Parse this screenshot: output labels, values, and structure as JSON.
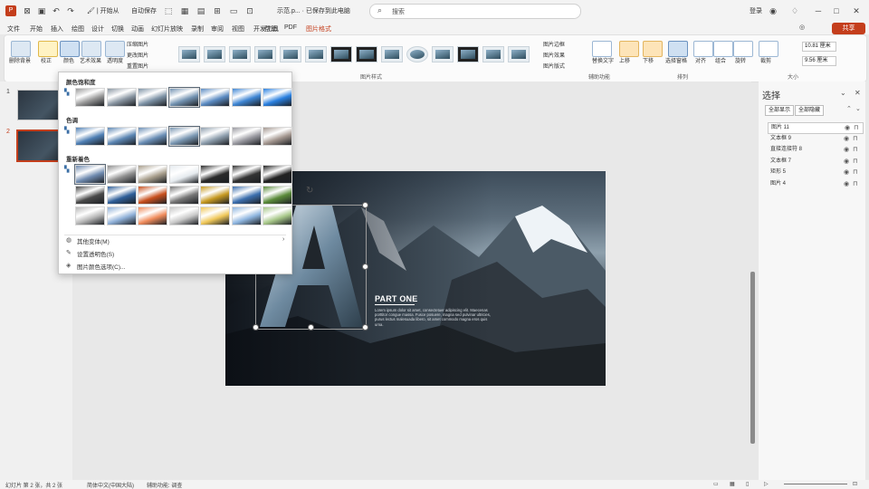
{
  "titlebar": {
    "menu_quick": [
      "文件",
      "开始",
      "插入",
      "绘图",
      "设计",
      "切换",
      "动画",
      "幻灯片放映",
      "审阅",
      "视图",
      "开发工具",
      "帮助",
      "PDF"
    ],
    "autosave_label": "自动保存",
    "doc_title": "示范.p... · 已保存到此电脑",
    "search_placeholder": "搜索",
    "user": "登录",
    "share_label": "共享"
  },
  "tabs": {
    "file": "文件",
    "home": "开始",
    "insert": "插入",
    "draw": "绘图",
    "design": "设计",
    "transitions": "切换",
    "animations": "动画",
    "slideshow": "幻灯片放映",
    "record": "录制",
    "review": "审阅",
    "view": "视图",
    "developer": "开发工具",
    "help": "帮助",
    "pdf": "PDF",
    "picture_format": "图片格式"
  },
  "ribbon": {
    "remove_bg": "删除背景",
    "corrections": "校正",
    "color": "颜色",
    "artistic": "艺术效果",
    "transparency": "透明度",
    "compress": "压缩图片",
    "change_picture": "更改图片",
    "reset_picture": "重置图片",
    "picture_styles_label": "图片样式",
    "picture_border": "图片边框",
    "picture_effects": "图片效果",
    "picture_layout": "图片版式",
    "accessibility_label": "辅助功能",
    "alt_text": "替换文字",
    "arrange_label": "排列",
    "bring_forward": "上移",
    "send_backward": "下移",
    "selection_pane": "选择窗格",
    "align": "对齐",
    "group": "组合",
    "rotate": "旋转",
    "crop": "裁剪",
    "height": "10.81 厘米",
    "width": "9.56 厘米",
    "size_label": "大小"
  },
  "dropdown": {
    "saturation_head": "颜色饱和度",
    "tone_head": "色调",
    "recolor_head": "重新着色",
    "more_variations": "其他变体(M)",
    "set_transparent": "设置透明色(S)",
    "picture_color_options": "图片颜色选项(C)..."
  },
  "slides": {
    "numbers": [
      "1",
      "2"
    ]
  },
  "slide": {
    "part_title": "PART ONE",
    "body_text": "Lorem ipsum dolor sit amet, consectetuer adipiscing elit. Maecenas porttitor congue massa. Fusce posuere, magna sed pulvinar ultricies, purus lectus malesuada libero, sit amet commodo magna eros quis urna.",
    "big_letter": "A"
  },
  "selection_pane": {
    "title": "选择",
    "show_all": "全部显示",
    "hide_all": "全部隐藏",
    "objects": [
      {
        "name": "图片 11",
        "selected": true
      },
      {
        "name": "文本框 9",
        "selected": false
      },
      {
        "name": "直接连接符 8",
        "selected": false
      },
      {
        "name": "文本框 7",
        "selected": false
      },
      {
        "name": "矩形 5",
        "selected": false
      },
      {
        "name": "图片 4",
        "selected": false
      }
    ]
  },
  "status": {
    "slide_info": "幻灯片 第 2 张，共 2 张",
    "language": "简体中文(中国大陆)",
    "accessibility": "辅助功能: 调查"
  },
  "colors": {
    "accent": "#c43e1c",
    "ribbon_bg": "#fbfbfb",
    "titlebar_bg": "#f3f3f3"
  }
}
